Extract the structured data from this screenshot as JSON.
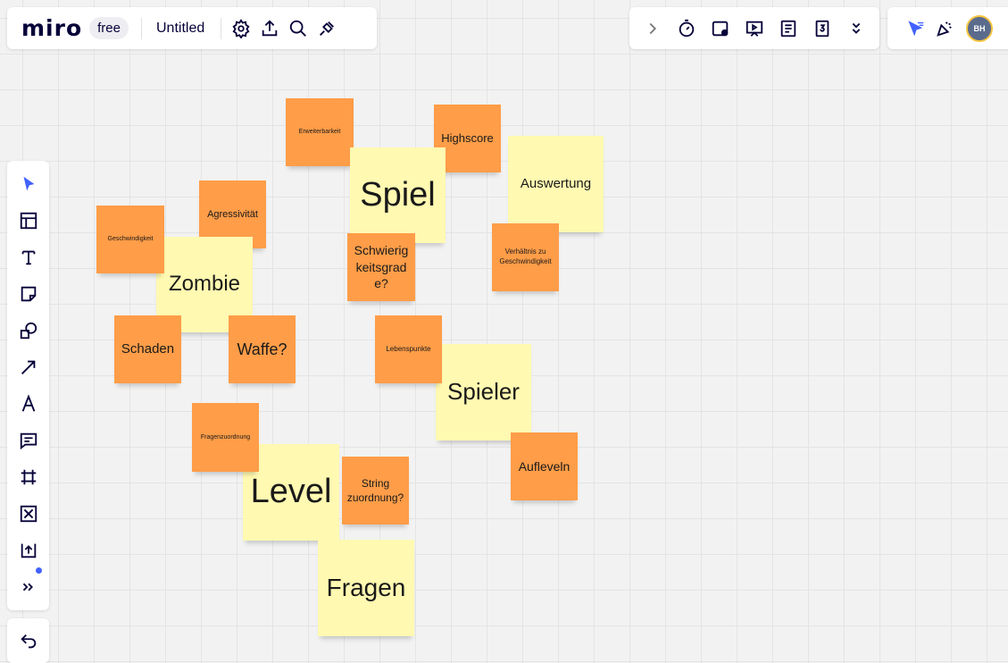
{
  "header": {
    "logo": "miro",
    "plan": "free",
    "board_title": "Untitled"
  },
  "toolbar": {
    "icons": [
      "select-icon",
      "templates-icon",
      "text-icon",
      "sticky-note-icon",
      "shapes-icon",
      "arrow-icon",
      "pen-icon",
      "comment-icon",
      "frame-icon",
      "embed-icon",
      "upload-icon",
      "more-tools-icon"
    ]
  },
  "user": {
    "initials": "BH"
  },
  "colors": {
    "yellow": "#fff9b1",
    "orange": "#ff9d48",
    "accent": "#4262ff"
  },
  "stickies": [
    {
      "text": "Erweiterbarkeit",
      "color": "orange"
    },
    {
      "text": "Highscore",
      "color": "orange"
    },
    {
      "text": "Spiel",
      "color": "yellow"
    },
    {
      "text": "Auswertung",
      "color": "yellow"
    },
    {
      "text": "Agressivität",
      "color": "orange"
    },
    {
      "text": "Geschwindigkeit",
      "color": "orange"
    },
    {
      "text": "Zombie",
      "color": "yellow"
    },
    {
      "text": "Schwierigkeitsgrade?",
      "color": "orange"
    },
    {
      "text": "Verhältnis zu Geschwindigkeit",
      "color": "orange"
    },
    {
      "text": "Schaden",
      "color": "orange"
    },
    {
      "text": "Waffe?",
      "color": "orange"
    },
    {
      "text": "Lebenspunkte",
      "color": "orange"
    },
    {
      "text": "Spieler",
      "color": "yellow"
    },
    {
      "text": "Fragenzuordnung",
      "color": "orange"
    },
    {
      "text": "Level",
      "color": "yellow"
    },
    {
      "text": "String zuordnung?",
      "color": "orange"
    },
    {
      "text": "Aufleveln",
      "color": "orange"
    },
    {
      "text": "Fragen",
      "color": "yellow"
    }
  ]
}
